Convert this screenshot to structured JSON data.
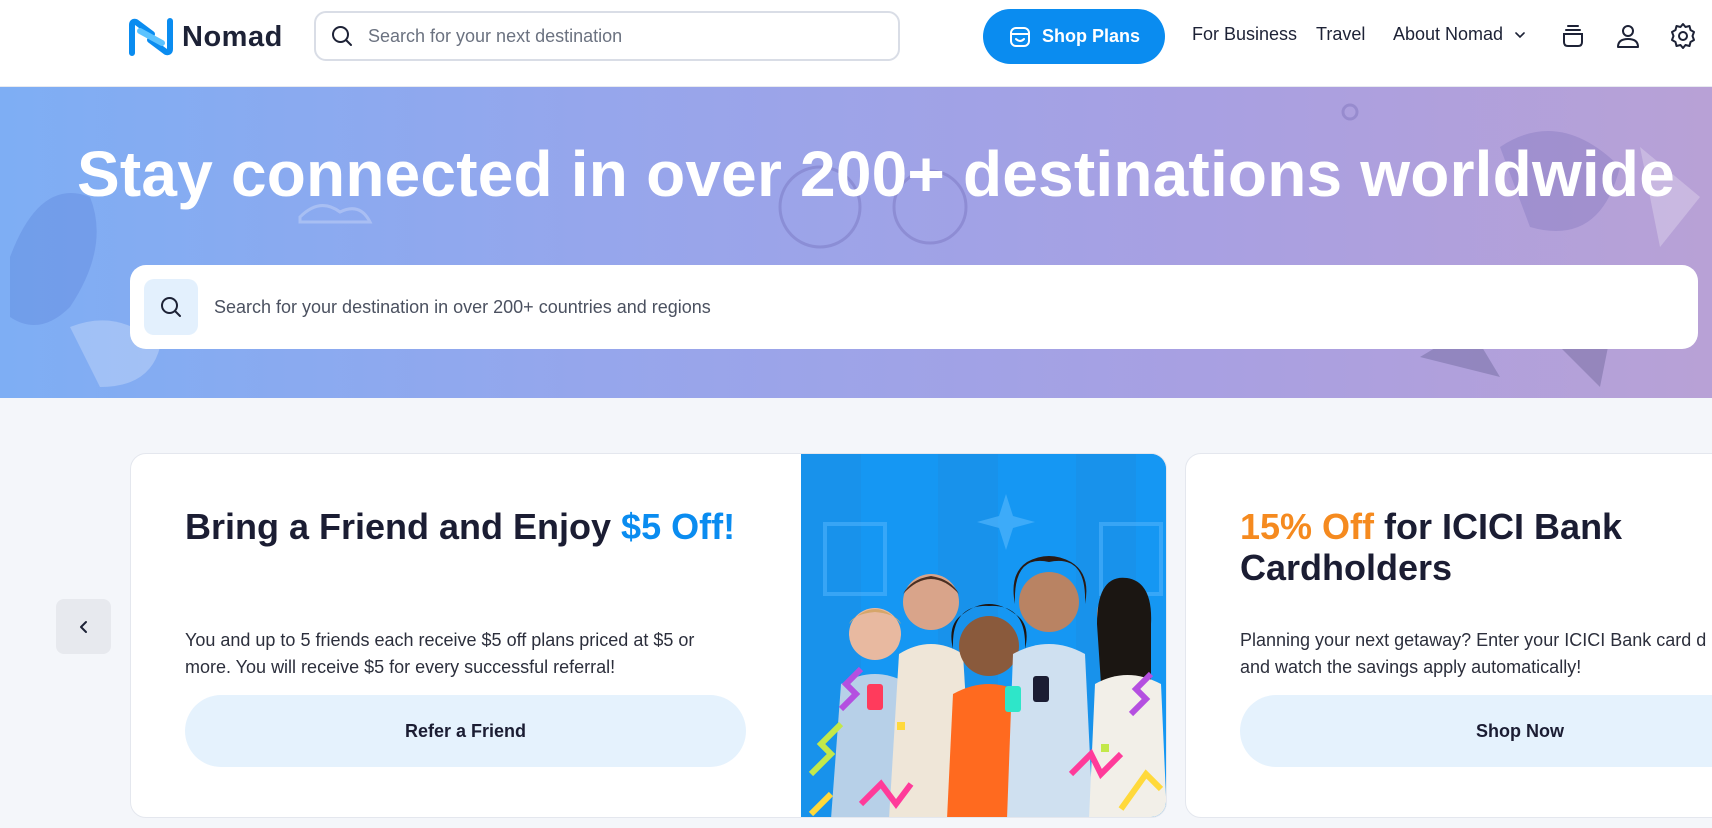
{
  "header": {
    "logo_text": "Nomad",
    "search_placeholder": "Search for your next destination",
    "shop_plans_label": "Shop Plans",
    "nav": {
      "business": "For Business",
      "travel": "Travel",
      "about": "About Nomad"
    },
    "icons": [
      "stack-icon",
      "user-icon",
      "gear-icon"
    ]
  },
  "hero": {
    "title": "Stay connected in over 200+ destinations worldwide",
    "search_placeholder": "Search for your destination in over 200+ countries and regions"
  },
  "promos": [
    {
      "title_main": "Bring a Friend and Enjoy ",
      "title_accent": "$5 Off!",
      "text": "You and up to 5 friends each receive $5 off plans priced at $5 or more. You will receive $5 for every successful referral!",
      "button": "Refer a Friend"
    },
    {
      "title_accent": "15% Off",
      "title_main": " for ICICI Bank Cardholders",
      "text_line1": "Planning your next getaway? Enter your ICICI Bank card d",
      "text_line2": "and watch the savings apply automatically!",
      "button": "Shop Now"
    }
  ],
  "colors": {
    "brand_blue": "#0a8cf0",
    "accent_orange": "#f58a1f",
    "button_light": "#e5f2fd"
  }
}
